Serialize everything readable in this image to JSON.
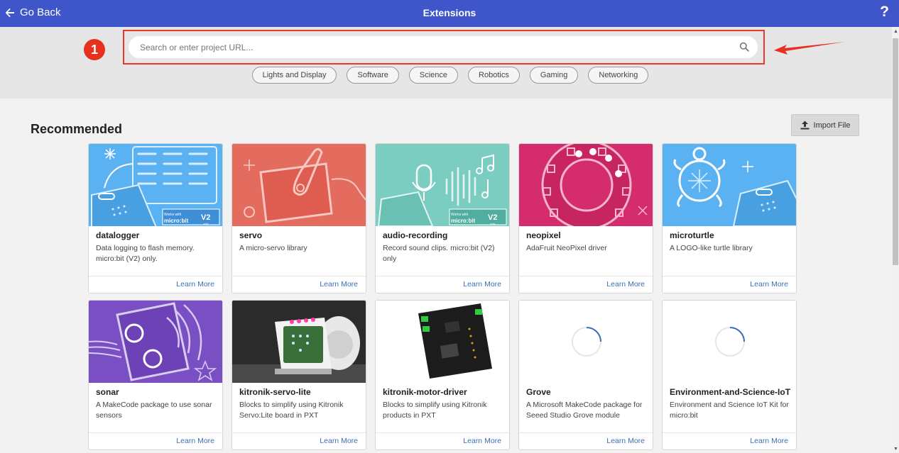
{
  "topbar": {
    "back_label": "Go Back",
    "title": "Extensions",
    "help_label": "?"
  },
  "search": {
    "placeholder": "Search or enter project URL...",
    "value": ""
  },
  "annotation": {
    "step_number": "1"
  },
  "tags": [
    "Lights and Display",
    "Software",
    "Science",
    "Robotics",
    "Gaming",
    "Networking"
  ],
  "section": {
    "title": "Recommended",
    "import_label": "Import File"
  },
  "cards": [
    {
      "name": "datalogger",
      "desc": "Data logging to flash memory. micro:bit (V2) only.",
      "learn": "Learn More",
      "badge_top": "Works with",
      "badge_mid": "micro:bit",
      "badge_v": "V2",
      "badge_only": "only"
    },
    {
      "name": "servo",
      "desc": "A micro-servo library",
      "learn": "Learn More"
    },
    {
      "name": "audio-recording",
      "desc": "Record sound clips. micro:bit (V2) only",
      "learn": "Learn More",
      "badge_top": "Works with",
      "badge_mid": "micro:bit",
      "badge_v": "V2",
      "badge_only": "only"
    },
    {
      "name": "neopixel",
      "desc": "AdaFruit NeoPixel driver",
      "learn": "Learn More"
    },
    {
      "name": "microturtle",
      "desc": "A LOGO-like turtle library",
      "learn": "Learn More"
    },
    {
      "name": "sonar",
      "desc": "A MakeCode package to use sonar sensors",
      "learn": "Learn More"
    },
    {
      "name": "kitronik-servo-lite",
      "desc": "Blocks to simplify using Kitronik Servo:Lite board in PXT",
      "learn": "Learn More"
    },
    {
      "name": "kitronik-motor-driver",
      "desc": "Blocks to simplify using Kitronik products in PXT",
      "learn": "Learn More"
    },
    {
      "name": "Grove",
      "desc": "A Microsoft MakeCode package for Seeed Studio Grove module",
      "learn": "Learn More"
    },
    {
      "name": "Environment-and-Science-IoT",
      "desc": "Environment and Science IoT Kit for micro:bit",
      "learn": "Learn More"
    }
  ],
  "colors": {
    "topbar": "#3f56cb",
    "datalogger": "#5bb2f2",
    "servo": "#e46c5e",
    "audio": "#7ccdc1",
    "neopixel": "#d42c6c",
    "microturtle": "#5bb2f2",
    "sonar": "#7a4fc4",
    "annotation": "#e8392c"
  }
}
